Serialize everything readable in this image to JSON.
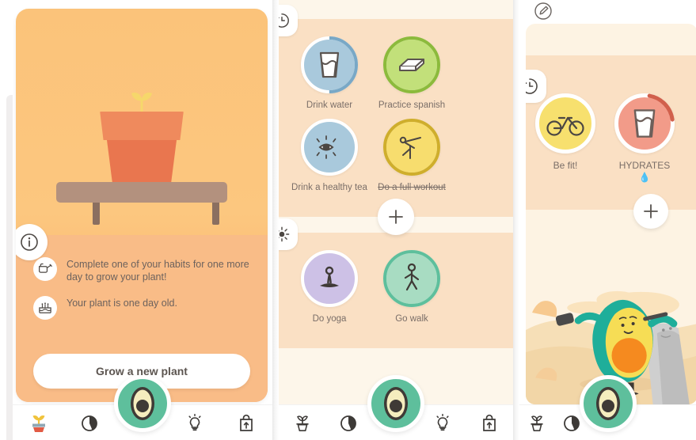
{
  "app": {
    "accent_green": "#5ebf9c",
    "card_orange": "#fbc37a",
    "band_peach": "#fae0c4",
    "panel_cream": "#fdf3e3"
  },
  "panel_plant": {
    "info_badge_icon": "info-icon",
    "messages": [
      {
        "icon": "watering-can-icon",
        "text": "Complete one of your habits for one more day to grow your plant!"
      },
      {
        "icon": "cake-icon",
        "text": "Your plant is one day old."
      }
    ],
    "grow_button_label": "Grow a new plant",
    "illustration": "potted-sprout-on-shelf"
  },
  "panel_habits": {
    "sections": [
      {
        "badge_icon": "clock-icon",
        "habits": [
          {
            "label": "Drink water",
            "icon": "water-glass-icon",
            "circle_color": "#a9c9dc",
            "ring_color": "#79a8c6",
            "ring_pct": 50,
            "done": false
          },
          {
            "label": "Practice spanish",
            "icon": "book-icon",
            "circle_color": "#c2e07a",
            "ring_color": "#8cba3c",
            "ring_pct": 100,
            "done": false
          },
          {
            "label": "Drink a healthy tea",
            "icon": "eye-icon",
            "circle_color": "#a9c9dc",
            "ring_color": "#a9c9dc",
            "ring_pct": 0,
            "done": false
          },
          {
            "label": "Do a full workout",
            "icon": "stretching-icon",
            "circle_color": "#f7dd6e",
            "ring_color": "#cfae2c",
            "ring_pct": 100,
            "done": true
          }
        ]
      },
      {
        "badge_icon": "sun-icon",
        "habits": [
          {
            "label": "Do yoga",
            "icon": "meditation-icon",
            "circle_color": "#cdc1e6",
            "ring_color": "#cdc1e6",
            "ring_pct": 0,
            "done": false
          },
          {
            "label": "Go walk",
            "icon": "walking-icon",
            "circle_color": "#a8dcc2",
            "ring_color": "#5ebf9c",
            "ring_pct": 100,
            "done": false
          }
        ]
      }
    ],
    "add_button_label": "+"
  },
  "panel_detail": {
    "edit_badge_icon": "pencil-icon",
    "clock_badge_icon": "clock-icon",
    "habits": [
      {
        "label": "Be fit!",
        "icon": "bicycle-icon",
        "circle_color": "#f7e06e",
        "ring_color": "#f7e06e",
        "ring_pct": 0,
        "emoji": ""
      },
      {
        "label": "HYDRATES",
        "icon": "water-glass-icon",
        "circle_color": "#f29b89",
        "ring_color": "#d1604c",
        "ring_pct": 20,
        "emoji": "💧"
      }
    ],
    "add_button_label": "+",
    "illustration": "avocado-mascot-lifting-rock-in-desert"
  },
  "navbar": {
    "items": [
      {
        "name": "plant",
        "icon": "plant-pot-icon",
        "selected": true
      },
      {
        "name": "stats",
        "icon": "pie-chart-icon",
        "selected": false
      },
      {
        "name": "avocado",
        "icon": "avocado-icon",
        "selected": false
      },
      {
        "name": "tips",
        "icon": "lightbulb-icon",
        "selected": false
      },
      {
        "name": "shop",
        "icon": "shopping-bag-icon",
        "selected": false
      }
    ]
  }
}
